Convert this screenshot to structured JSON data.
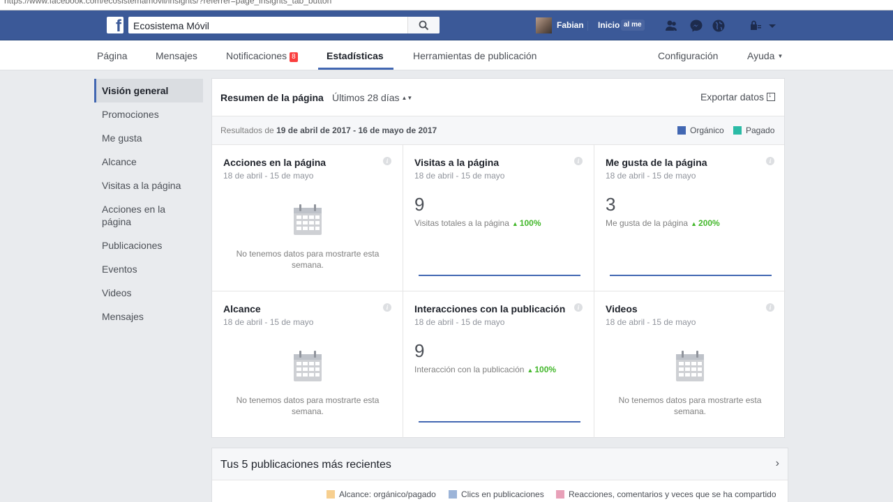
{
  "browser": {
    "url": "https://www.facebook.com/ecosistemamovil/insights/?referrer=page_insights_tab_button"
  },
  "topbar": {
    "logo": "f",
    "search_value": "Ecosistema Móvil",
    "user_name": "Fabian",
    "home_label": "Inicio",
    "home_badge": "al me",
    "icons": [
      "friends-icon",
      "messenger-icon",
      "globe-icon",
      "lock-icon",
      "caret-down-icon"
    ]
  },
  "tabs": {
    "pagina": "Página",
    "mensajes": "Mensajes",
    "notificaciones": "Notificaciones",
    "notif_count": "8",
    "estadisticas": "Estadísticas",
    "herramientas": "Herramientas de publicación",
    "configuracion": "Configuración",
    "ayuda": "Ayuda"
  },
  "sidebar": {
    "items": [
      "Visión general",
      "Promociones",
      "Me gusta",
      "Alcance",
      "Visitas a la página",
      "Acciones en la página",
      "Publicaciones",
      "Eventos",
      "Videos",
      "Mensajes"
    ],
    "active_index": 0
  },
  "summary": {
    "title": "Resumen de la página",
    "range": "Últimos 28 días",
    "export": "Exportar datos",
    "results_prefix": "Resultados de",
    "results_range": "19 de abril de 2017 - 16 de mayo de 2017",
    "legend_organic": "Orgánico",
    "legend_paid": "Pagado",
    "colors": {
      "organic": "#4267b2",
      "paid": "#2bbba6"
    }
  },
  "metrics": [
    {
      "title": "Acciones en la página",
      "date": "18 de abril - 15 de mayo",
      "empty_text": "No tenemos datos para mostrarte esta semana."
    },
    {
      "title": "Visitas a la página",
      "date": "18 de abril - 15 de mayo",
      "value": "9",
      "subtitle": "Visitas totales a la página",
      "delta": "100%"
    },
    {
      "title": "Me gusta de la página",
      "date": "18 de abril - 15 de mayo",
      "value": "3",
      "subtitle": "Me gusta de la página",
      "delta": "200%"
    },
    {
      "title": "Alcance",
      "date": "18 de abril - 15 de mayo",
      "empty_text": "No tenemos datos para mostrarte esta semana."
    },
    {
      "title": "Interacciones con la publicación",
      "date": "18 de abril - 15 de mayo",
      "value": "9",
      "subtitle": "Interacción con la publicación",
      "delta": "100%"
    },
    {
      "title": "Videos",
      "date": "18 de abril - 15 de mayo",
      "empty_text": "No tenemos datos para mostrarte esta semana."
    }
  ],
  "chart_data": [
    {
      "type": "line",
      "metric": "Visitas a la página",
      "series": [
        {
          "values": [
            0,
            0,
            0,
            0,
            0,
            0,
            0,
            0,
            0,
            0,
            0,
            0,
            0,
            0,
            0,
            0,
            0,
            0,
            0,
            0,
            0,
            0,
            0,
            0,
            0,
            0,
            0,
            0,
            0,
            0
          ]
        }
      ],
      "ylim": [
        0,
        3
      ]
    },
    {
      "type": "line",
      "metric": "Me gusta de la página",
      "series": [
        {
          "values": [
            0,
            0,
            0,
            0,
            0,
            0,
            0,
            0,
            0,
            0,
            0,
            0,
            0,
            0,
            0,
            0,
            0,
            0,
            0,
            0,
            0,
            0,
            0,
            0,
            0,
            0,
            0,
            0,
            0,
            0
          ]
        }
      ],
      "ylim": [
        0,
        1
      ]
    },
    {
      "type": "line",
      "metric": "Interacciones con la publicación",
      "series": [
        {
          "values": [
            0,
            0,
            0,
            0,
            0,
            0,
            0,
            0,
            0,
            0,
            0,
            0,
            0,
            0,
            0,
            0,
            0,
            0,
            0,
            0,
            0,
            0,
            0,
            0,
            0,
            0,
            0,
            0,
            0,
            0
          ]
        }
      ],
      "ylim": [
        0,
        3
      ]
    }
  ],
  "posts": {
    "title": "Tus 5 publicaciones más recientes",
    "legend": [
      {
        "label": "Alcance: orgánico/pagado",
        "color": "#f7cf8f"
      },
      {
        "label": "Clics en publicaciones",
        "color": "#9cb4d8"
      },
      {
        "label": "Reacciones, comentarios y veces que se ha compartido",
        "color": "#e8a0b8"
      }
    ]
  }
}
